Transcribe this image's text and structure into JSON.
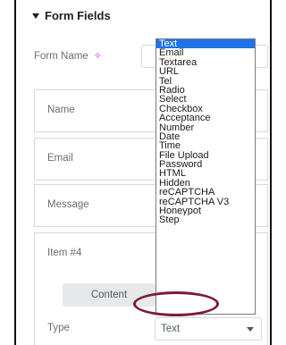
{
  "panel": {
    "section_title": "Form Fields",
    "form_name_label": "Form Name"
  },
  "repeater": {
    "items": [
      {
        "label": "Name"
      },
      {
        "label": "Email"
      },
      {
        "label": "Message"
      }
    ]
  },
  "item4": {
    "label": "Item #4",
    "tab_content": "Content",
    "type_label": "Type",
    "type_value": "Text"
  },
  "dropdown": {
    "selected": "Text",
    "options": [
      "Text",
      "Email",
      "Textarea",
      "URL",
      "Tel",
      "Radio",
      "Select",
      "Checkbox",
      "Acceptance",
      "Number",
      "Date",
      "Time",
      "File Upload",
      "Password",
      "HTML",
      "Hidden",
      "reCAPTCHA",
      "reCAPTCHA V3",
      "Honeypot",
      "Step"
    ]
  },
  "colors": {
    "selected_option_bg": "#1e73e8",
    "highlight_oval": "#7d1a38",
    "sparkle": "#c13fd6"
  },
  "icons": {
    "section_caret": "caret-down-icon",
    "ai_sparkle": "sparkle-icon",
    "select_caret": "chevron-down-icon"
  }
}
